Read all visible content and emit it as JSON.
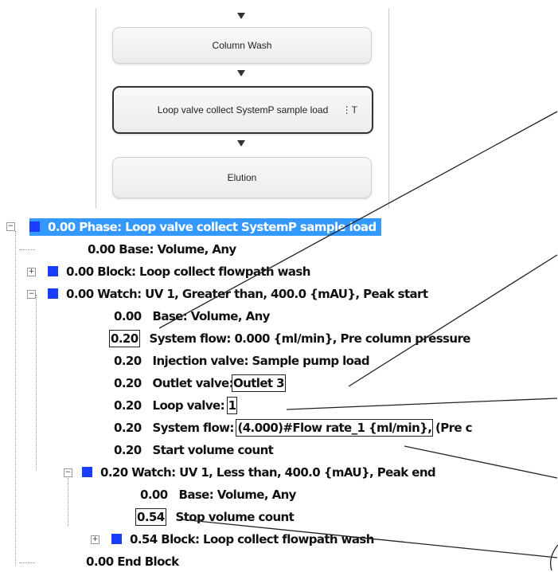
{
  "flow": {
    "steps": [
      "Column Wash",
      "Loop valve collect SystemP sample load",
      "Elution"
    ],
    "more_icon": "⋮T"
  },
  "tree": {
    "phase": "0.00   Phase: Loop valve collect SystemP sample load",
    "rows": [
      "0.00   Base: Volume, Any",
      "0.00   Block: Loop collect flowpath wash",
      "0.00   Watch: UV 1, Greater than, 400.0 {mAU}, Peak start"
    ],
    "watch1": {
      "base": {
        "time": "0.00",
        "text": "Base: Volume, Any"
      },
      "system_flow_1": {
        "time": "0.20",
        "text": "System flow: 0.000 {ml/min}, Pre column pressure"
      },
      "injection": {
        "time": "0.20",
        "text": "Injection valve: Sample pump load"
      },
      "outlet": {
        "time": "0.20",
        "label": "Outlet valve:",
        "value": "Outlet 3"
      },
      "loop": {
        "time": "0.20",
        "label": "Loop valve:",
        "value": "1"
      },
      "system_flow_2": {
        "time": "0.20",
        "label": "System flow:",
        "value": "(4.000)#Flow rate_1 {ml/min},",
        "suffix": "(Pre c"
      },
      "start_count": {
        "time": "0.20",
        "text": "Start volume count"
      }
    },
    "watch2": {
      "header": "0.20   Watch: UV 1, Less than, 400.0 {mAU}, Peak end",
      "base": {
        "time": "0.00",
        "text": "Base: Volume, Any"
      },
      "stop": {
        "time": "0.54",
        "text": "Stop volume count"
      },
      "block": "0.54   Block: Loop collect flowpath wash"
    },
    "end": "0.00   End  Block"
  }
}
